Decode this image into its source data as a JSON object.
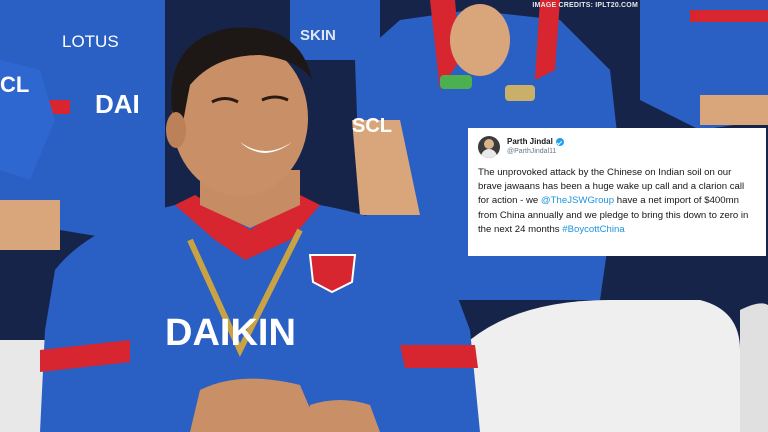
{
  "image_credit": "IMAGE CREDITS: IPLT20.COM",
  "jersey_text": {
    "sponsor_chest": "DAIKIN",
    "sponsor_left_background": "DAI",
    "sponsor_top_left": "LOTUS",
    "sponsor_center_top": "SKIN",
    "sleeve_left": "CL",
    "sleeve_center": "SCL"
  },
  "tweet": {
    "author_name": "Parth Jindal",
    "handle": "@ParthJindal11",
    "text_part1": "The unprovoked attack by the Chinese on Indian soil on our brave jawaans has been a huge wake up call and a clarion call for action - we ",
    "mention": "@TheJSWGroup",
    "text_part2": " have a net import of $400mn from China annually and we pledge to bring this down to zero in the next 24 months ",
    "hashtag": "#BoycottChina"
  },
  "colors": {
    "jersey_blue": "#2a5fc4",
    "jersey_red": "#d7262f",
    "seat_white": "#efefef",
    "link_blue": "#1b95e0"
  }
}
